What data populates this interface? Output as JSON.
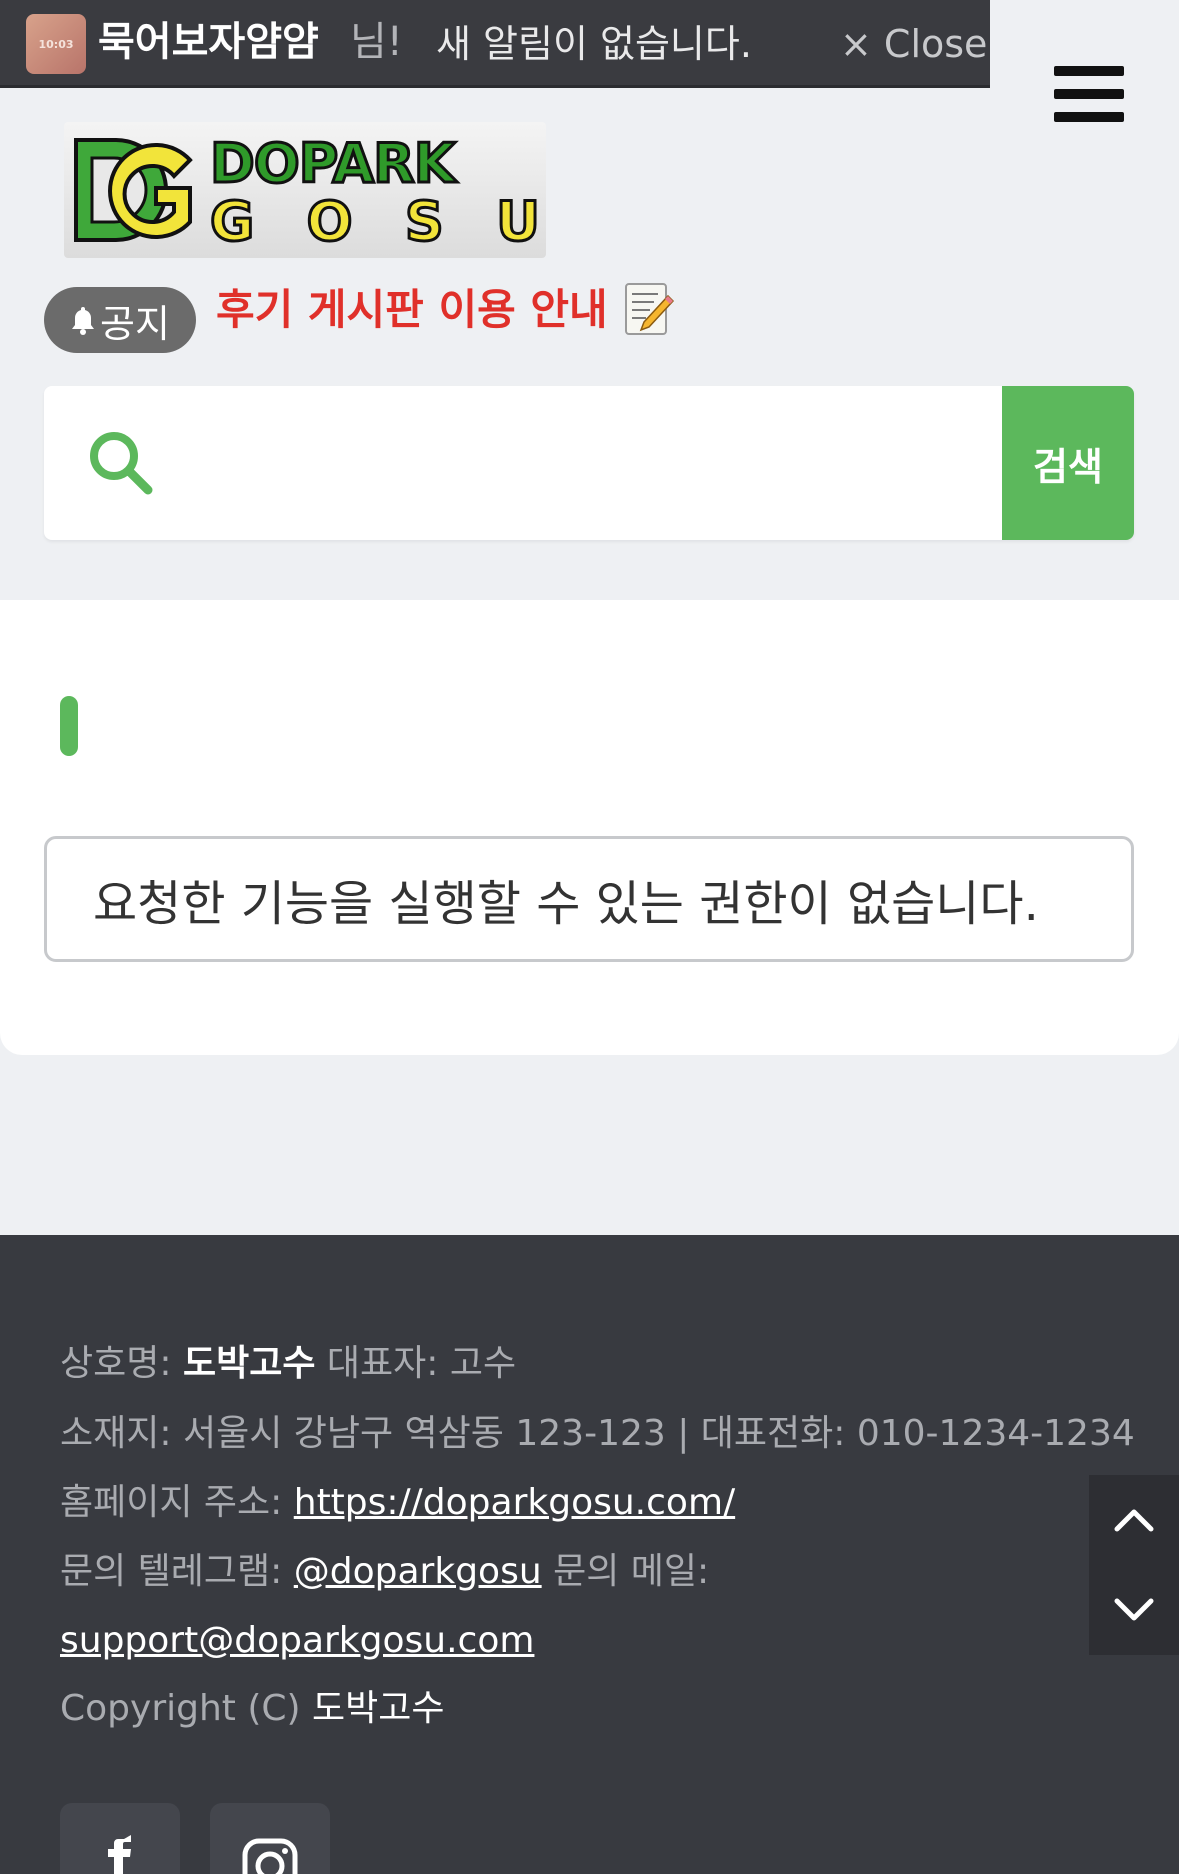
{
  "notification": {
    "avatar_text": "10:03",
    "nickname": "묵어보자얌얌",
    "suffix": "님!",
    "message": "새 알림이 없습니다.",
    "close_label": "× Close"
  },
  "logo": {
    "line1": "DOPARK",
    "line2": [
      "G",
      "O",
      "S",
      "U"
    ]
  },
  "notice": {
    "badge": "공지",
    "link_text": "후기 게시판 이용 안내"
  },
  "search": {
    "placeholder": "",
    "button_label": "검색"
  },
  "content": {
    "alert_message": "요청한 기능을 실행할 수 있는 권한이 없습니다."
  },
  "footer": {
    "company_label": "상호명:",
    "company_name": "도박고수",
    "ceo_label": "대표자:",
    "ceo_name": "고수",
    "address_label": "소재지:",
    "address": "서울시 강남구 역삼동 123-123 | 대표전화: 010-1234-1234",
    "homepage_label": "홈페이지 주소:",
    "homepage_url": "https://doparkgosu.com/",
    "telegram_label": "문의 텔레그램:",
    "telegram_handle": "@doparkgosu",
    "mail_label": "문의 메일:",
    "mail": "support@doparkgosu.com",
    "copyright_prefix": "Copyright (C)",
    "copyright_name": "도박고수"
  },
  "colors": {
    "accent_green": "#5cb85c",
    "notice_red": "#e0302a",
    "footer_bg": "#383a40"
  },
  "icons": [
    "bell-icon",
    "memo-pencil-icon",
    "search-icon",
    "hamburger-menu-icon",
    "chevron-up-icon",
    "chevron-down-icon",
    "facebook-icon",
    "instagram-icon"
  ]
}
